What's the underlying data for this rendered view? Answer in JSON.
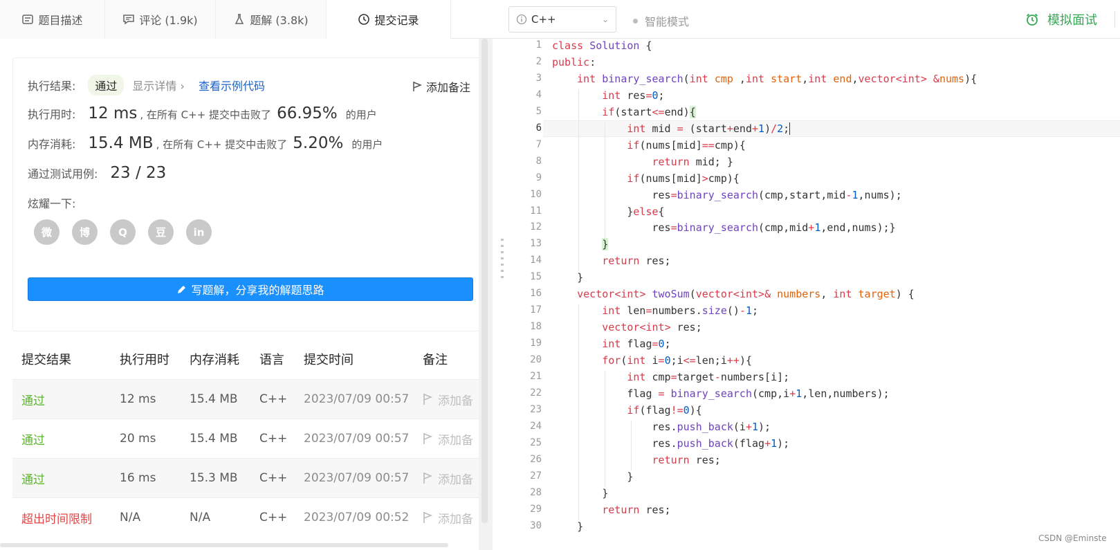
{
  "tabs": [
    {
      "label": "题目描述",
      "icon": "description-icon"
    },
    {
      "label": "评论 (1.9k)",
      "icon": "comment-icon"
    },
    {
      "label": "题解 (3.8k)",
      "icon": "flask-icon"
    },
    {
      "label": "提交记录",
      "icon": "clock-icon"
    }
  ],
  "editor_bar": {
    "language": "C++",
    "smart_mode": "智能模式",
    "mock_interview": "模拟面试"
  },
  "result": {
    "result_label": "执行结果:",
    "result_value": "通过",
    "show_detail": "显示详情",
    "view_sample": "查看示例代码",
    "add_note": "添加备注",
    "time_label": "执行用时:",
    "time_value": "12 ms",
    "time_mid": ", 在所有 C++ 提交中击败了",
    "time_pct": "66.95%",
    "time_tail": "的用户",
    "mem_label": "内存消耗:",
    "mem_value": "15.4 MB",
    "mem_mid": ", 在所有 C++ 提交中击败了",
    "mem_pct": "5.20%",
    "mem_tail": "的用户",
    "tests_label": "通过测试用例:",
    "tests_value": "23 / 23",
    "share_label": "炫耀一下:",
    "share_icons": [
      "wechat-icon",
      "weibo-icon",
      "qq-icon",
      "douban-icon",
      "linkedin-icon"
    ],
    "share_glyphs": [
      "微",
      "博",
      "Q",
      "豆",
      "in"
    ],
    "write_button": "写题解，分享我的解题思路"
  },
  "submissions": {
    "headers": [
      "提交结果",
      "执行用时",
      "内存消耗",
      "语言",
      "提交时间",
      "备注"
    ],
    "rows": [
      {
        "status": "通过",
        "time": "12 ms",
        "memory": "15.4 MB",
        "lang": "C++",
        "date": "2023/07/09 00:57",
        "note": "添加备"
      },
      {
        "status": "通过",
        "time": "20 ms",
        "memory": "15.4 MB",
        "lang": "C++",
        "date": "2023/07/09 00:57",
        "note": "添加备"
      },
      {
        "status": "通过",
        "time": "16 ms",
        "memory": "15.3 MB",
        "lang": "C++",
        "date": "2023/07/09 00:57",
        "note": "添加备"
      },
      {
        "status": "超出时间限制",
        "time": "N/A",
        "memory": "N/A",
        "lang": "C++",
        "date": "2023/07/09 00:52",
        "note": "添加备"
      }
    ]
  },
  "code_lines": [
    "class Solution {",
    "public:",
    "    int binary_search(int cmp ,int start,int end,vector<int> &nums){",
    "        int res=0;",
    "        if(start<=end){",
    "            int mid = (start+end+1)/2;",
    "            if(nums[mid]==cmp){",
    "                return mid; }",
    "            if(nums[mid]>cmp){",
    "                res=binary_search(cmp,start,mid-1,nums);",
    "            }else{",
    "                res=binary_search(cmp,mid+1,end,nums);}",
    "        }",
    "        return res;",
    "    }",
    "    vector<int> twoSum(vector<int>& numbers, int target) {",
    "        int len=numbers.size()-1;",
    "        vector<int> res;",
    "        int flag=0;",
    "        for(int i=0;i<=len;i++){",
    "            int cmp=target-numbers[i];",
    "            flag = binary_search(cmp,i+1,len,numbers);",
    "            if(flag!=0){",
    "                res.push_back(i+1);",
    "                res.push_back(flag+1);",
    "                return res;",
    "            }",
    "        }",
    "        return res;",
    "    }"
  ],
  "watermark": "CSDN @Eminste"
}
